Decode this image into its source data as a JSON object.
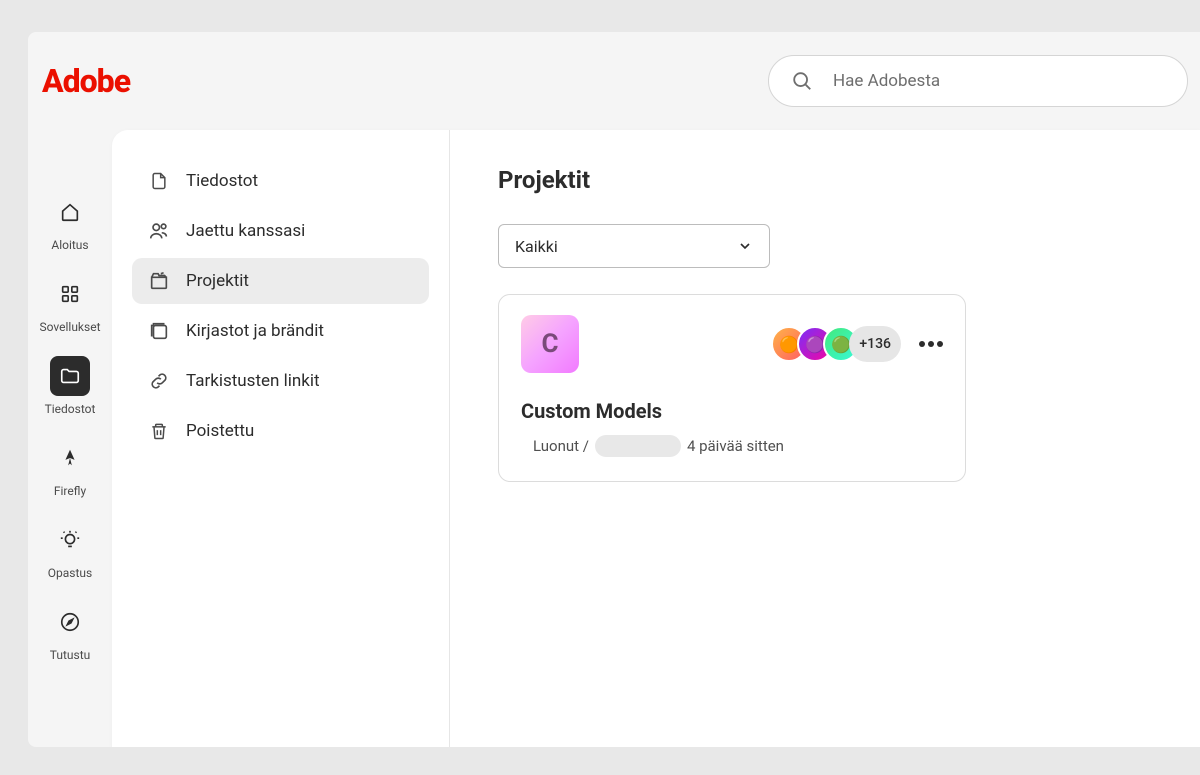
{
  "brand": "Adobe",
  "search": {
    "placeholder": "Hae Adobesta"
  },
  "rail": {
    "items": [
      {
        "label": "Aloitus"
      },
      {
        "label": "Sovellukset"
      },
      {
        "label": "Tiedostot"
      },
      {
        "label": "Firefly"
      },
      {
        "label": "Opastus"
      },
      {
        "label": "Tutustu"
      }
    ]
  },
  "sidenav": {
    "items": [
      {
        "label": "Tiedostot"
      },
      {
        "label": "Jaettu kanssasi"
      },
      {
        "label": "Projektit"
      },
      {
        "label": "Kirjastot ja brändit"
      },
      {
        "label": "Tarkistusten linkit"
      },
      {
        "label": "Poistettu"
      }
    ]
  },
  "content": {
    "title": "Projektit",
    "filter": "Kaikki",
    "project": {
      "initial": "C",
      "extra_count": "+136",
      "name": "Custom Models",
      "created_prefix": "Luonut /",
      "created_ago": "4 päivää sitten"
    }
  }
}
